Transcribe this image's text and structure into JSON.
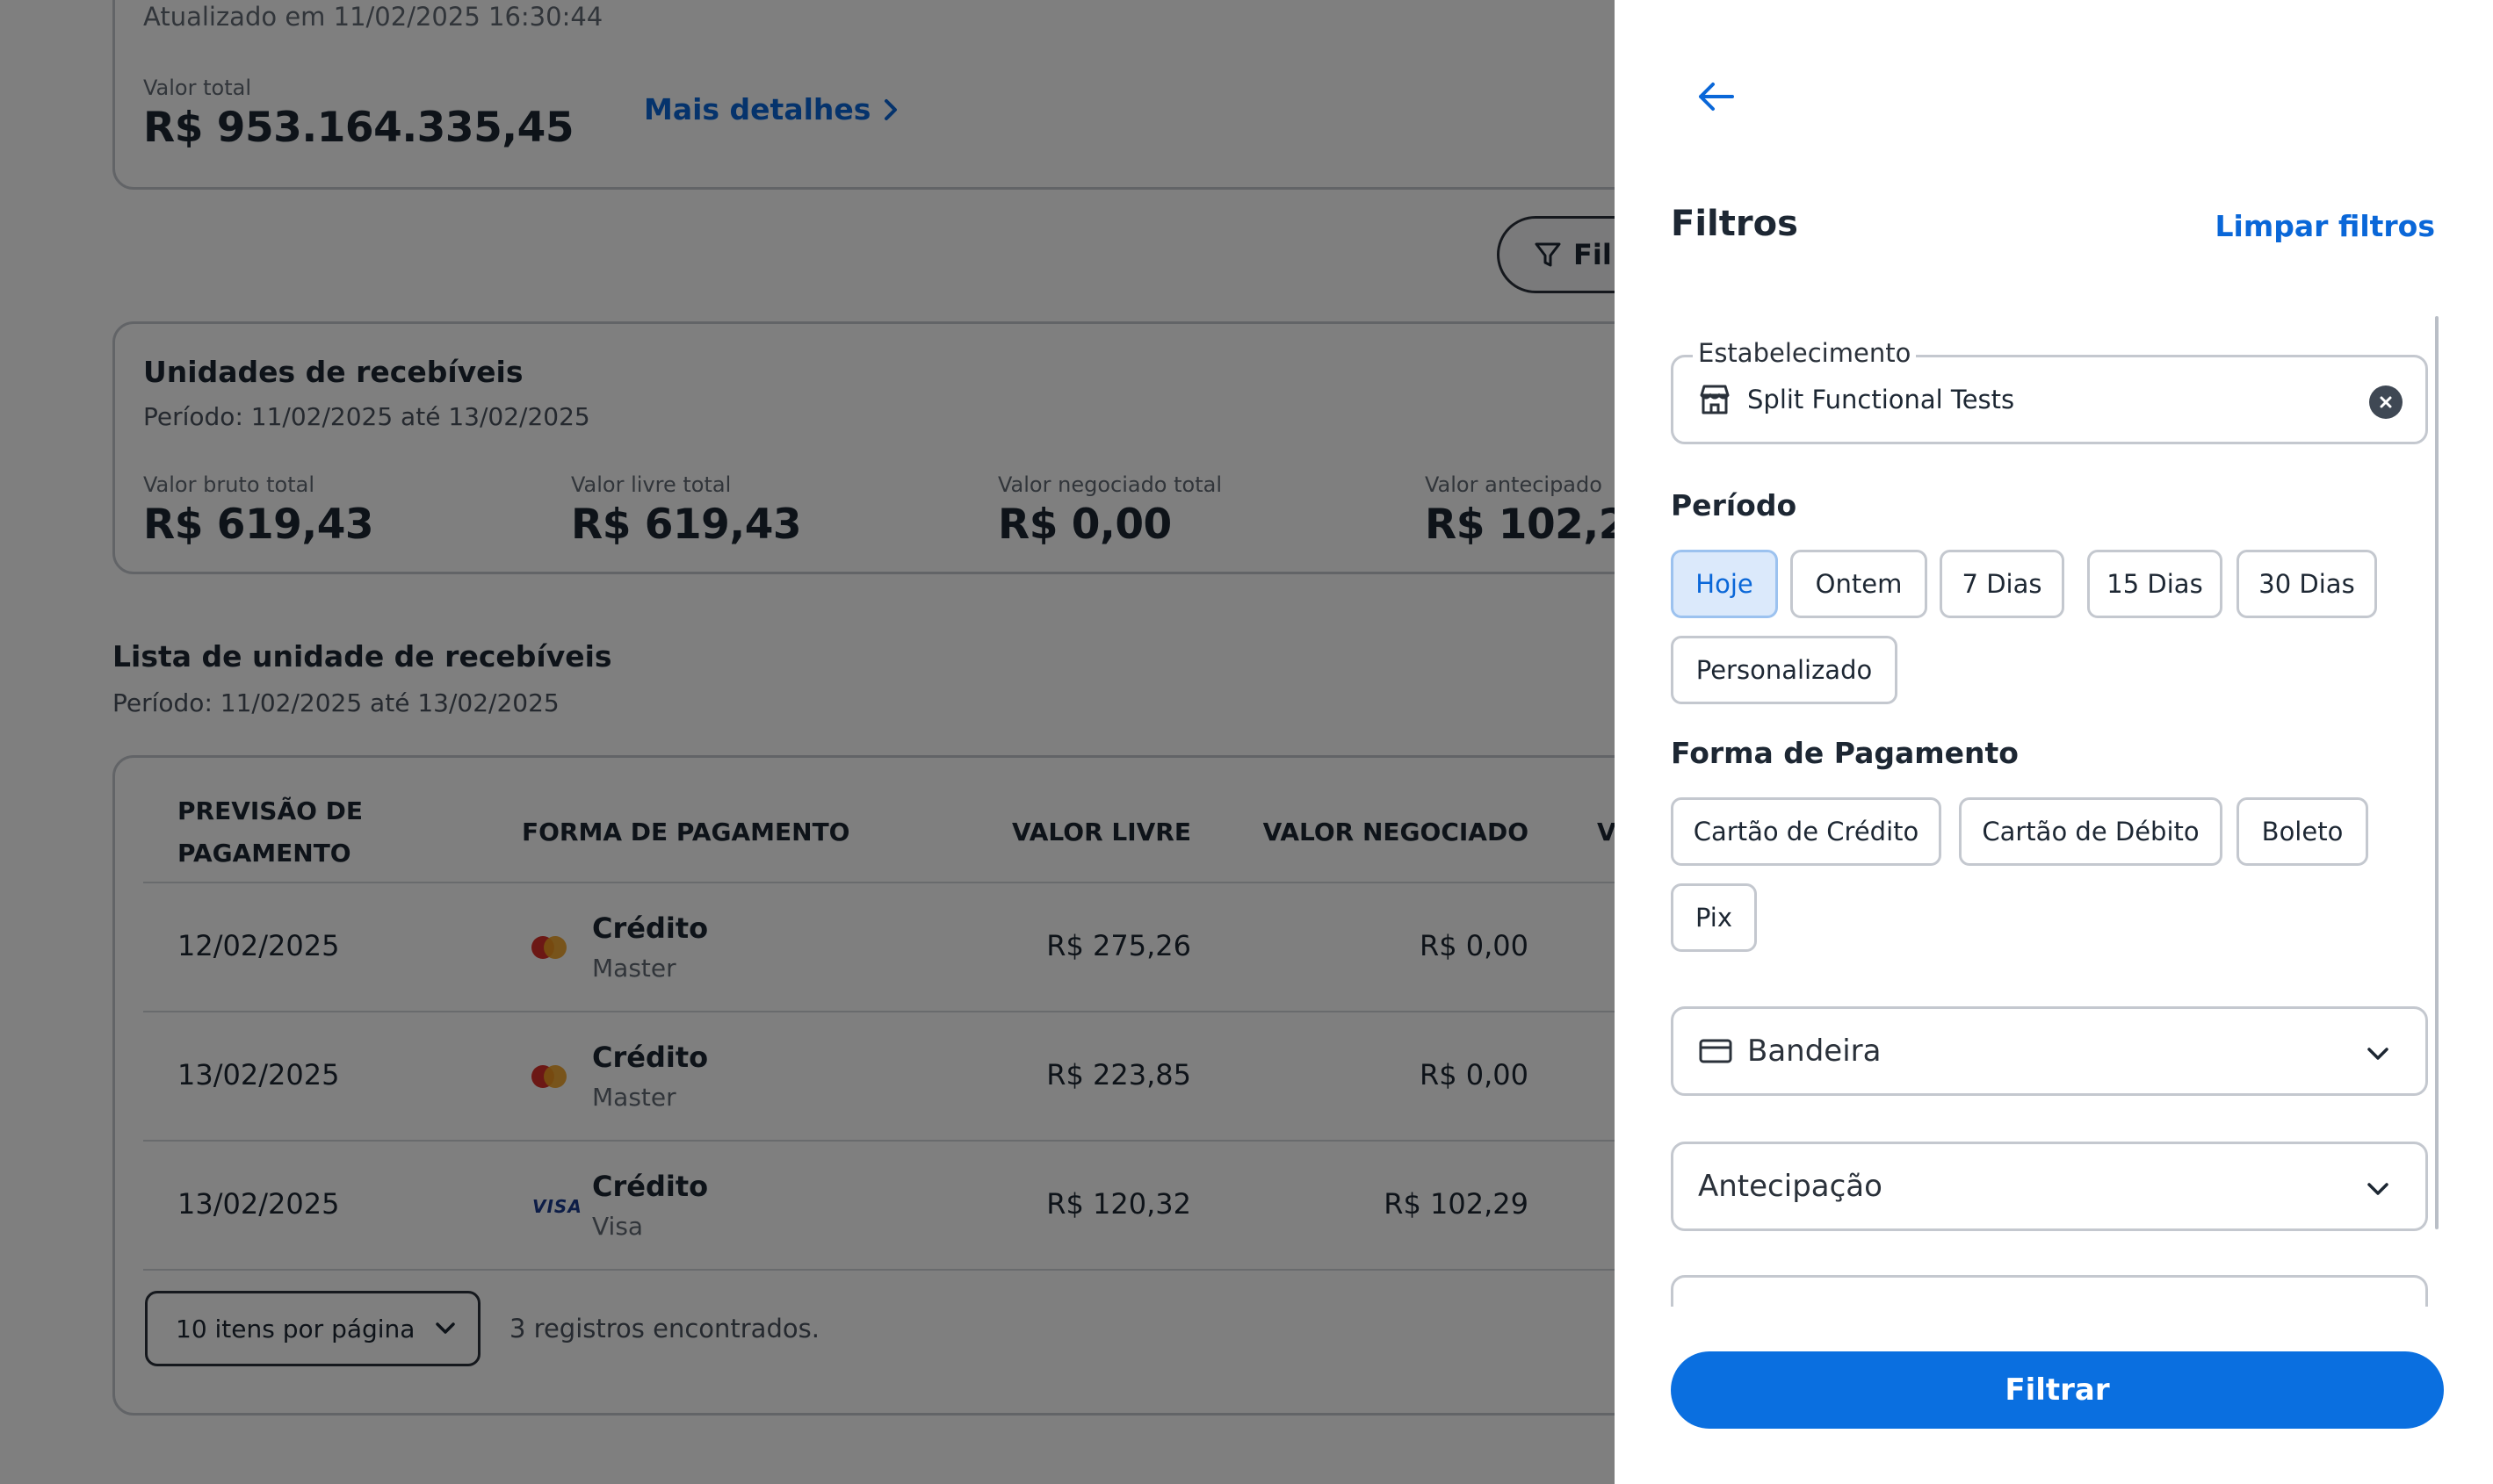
{
  "summary": {
    "updated": "Atualizado em 11/02/2025 16:30:44",
    "total_label": "Valor total",
    "total_value": "R$ 953.164.335,45",
    "details_link": "Mais detalhes",
    "filter_pill_label": "Fil"
  },
  "units": {
    "title": "Unidades de recebíveis",
    "period": "Período: 11/02/2025 até 13/02/2025",
    "metrics": [
      {
        "label": "Valor bruto total",
        "value": "R$ 619,43"
      },
      {
        "label": "Valor livre total",
        "value": "R$ 619,43"
      },
      {
        "label": "Valor negociado total",
        "value": "R$ 0,00"
      },
      {
        "label": "Valor antecipado",
        "value": "R$ 102,2"
      }
    ]
  },
  "list": {
    "title": "Lista de unidade de recebíveis",
    "period": "Período: 11/02/2025 até 13/02/2025",
    "headers": [
      "PREVISÃO DE PAGAMENTO",
      "FORMA DE PAGAMENTO",
      "VALOR LIVRE",
      "VALOR NEGOCIADO",
      "V"
    ],
    "rows": [
      {
        "date": "12/02/2025",
        "method": "Crédito",
        "brand": "Master",
        "brand_icon": "mastercard-icon",
        "free": "R$ 275,26",
        "negotiated": "R$ 0,00"
      },
      {
        "date": "13/02/2025",
        "method": "Crédito",
        "brand": "Master",
        "brand_icon": "mastercard-icon",
        "free": "R$ 223,85",
        "negotiated": "R$ 0,00"
      },
      {
        "date": "13/02/2025",
        "method": "Crédito",
        "brand": "Visa",
        "brand_icon": "visa-icon",
        "free": "R$ 120,32",
        "negotiated": "R$ 102,29"
      }
    ],
    "visa_mark": "VISA",
    "per_page": "10 itens por página",
    "records": "3 registros encontrados."
  },
  "drawer": {
    "title": "Filtros",
    "clear": "Limpar filtros",
    "establishment": {
      "legend": "Estabelecimento",
      "value": "Split Functional Tests"
    },
    "period": {
      "title": "Período",
      "options": [
        "Hoje",
        "Ontem",
        "7 Dias",
        "15 Dias",
        "30 Dias",
        "Personalizado"
      ],
      "selected": "Hoje"
    },
    "payment": {
      "title": "Forma de Pagamento",
      "options": [
        "Cartão de Crédito",
        "Cartão de Débito",
        "Boleto",
        "Pix"
      ]
    },
    "brand_select": "Bandeira",
    "anticipation_select": "Antecipação",
    "submit": "Filtrar"
  },
  "colors": {
    "accent": "#0a67d8",
    "button": "#0a6fe0",
    "chip_selected_bg": "#dbe9fb",
    "overlay": "rgba(0,0,0,0.5)"
  }
}
